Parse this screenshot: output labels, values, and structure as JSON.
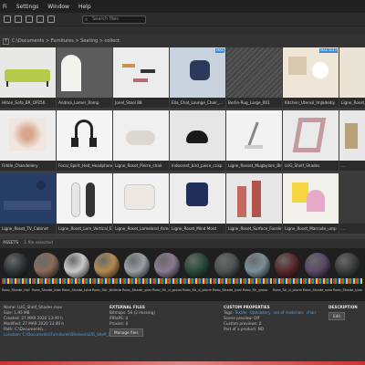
{
  "menubar": {
    "items": [
      "Fi",
      "Settings",
      "Window",
      "Help"
    ]
  },
  "toolbar": {
    "search_placeholder": "Search files"
  },
  "breadcrumb": {
    "path": "C:\\Documents > Furnitures > Seating > collect"
  },
  "tiles": [
    {
      "label": "Hilton_Sofa_BR_OP250",
      "badge": ""
    },
    {
      "label": "Andrea_Lamer_Ramp",
      "badge": ""
    },
    {
      "label": "Jonel_Stool 88",
      "badge": ""
    },
    {
      "label": "Ella_Chat_Lounge_Chair_...",
      "badge": ""
    },
    {
      "label": "Berlin-Rug_Large_001",
      "badge": ""
    },
    {
      "label": "Kitchen_Utensil_ImJadedly",
      "badge": "MAX 2013"
    },
    {
      "label": "Ligne_Roset_...",
      "badge": ""
    },
    {
      "label": "Fiddle_Chandeliery",
      "badge": ""
    },
    {
      "label": "Focal_Spirit_Hed_Headphones",
      "badge": ""
    },
    {
      "label": "Ligne_Roset_Pierre_chair",
      "badge": ""
    },
    {
      "label": "Indoorest_bird_piece_crisp",
      "badge": ""
    },
    {
      "label": "Ligne_Rosset_Mugbylam_Bird_Lam",
      "badge": ""
    },
    {
      "label": "LUG_Shelf_Shades",
      "badge": ""
    },
    {
      "label": "...",
      "badge": ""
    },
    {
      "label": "Ligne_Roset_TV_Cabinet",
      "badge": ""
    },
    {
      "label": "Ligne_Roset_Lom_Vertical_Ext",
      "badge": ""
    },
    {
      "label": "Ligne_Roset_Lomeland_Armchair",
      "badge": ""
    },
    {
      "label": "Ligne_Roset_Mind Mont",
      "badge": ""
    },
    {
      "label": "Ligne_Roset_Surface_Faceline",
      "badge": ""
    },
    {
      "label": "Ligne_Roset_Marcade_ump",
      "badge": ""
    },
    {
      "label": "...",
      "badge": ""
    }
  ],
  "materials_header": {
    "title": "ASSETS",
    "count": "1 file selected"
  },
  "materials": [
    {
      "label": "Roro_Shade_Hol",
      "color": "#2f3538"
    },
    {
      "label": "Roro_Shade_blanc",
      "color": "#8a6a5c"
    },
    {
      "label": "Roro_Shade_Iside",
      "color": "#c9c9c9"
    },
    {
      "label": "Roro_Shr_Aldirdeat",
      "color": "#b28a52"
    },
    {
      "label": "Roro_Shade_gram",
      "color": "#9aa0a4"
    },
    {
      "label": "Roro_Sh_d_grous",
      "color": "#8a7a90"
    },
    {
      "label": "Roro_Sh_d_plums",
      "color": "#2a4a3a"
    },
    {
      "label": "Roro_Shade_Ijorm",
      "color": "#4c5452"
    },
    {
      "label": "Roro_Sh_gross",
      "color": "#7b8f96"
    },
    {
      "label": "Roro_Sh_d_plums2",
      "color": "#5a2a2a"
    },
    {
      "label": "Roro_Shade_sandpath",
      "color": "#5a4a6a"
    },
    {
      "label": "Roro_Shade_Ijonm",
      "color": "#3a3f3c"
    }
  ],
  "details": {
    "left_lines": [
      "Name: LUG_Shelf_Shades.max",
      "Size: 1.95 MB",
      "Created: 27 MAR 2020 13:49 h",
      "Modified: 27 MAR 2020 13:49 h",
      "Path: C:\\Documents\\...",
      "Location: C:\\Documents\\Furnitures\\Shelves\\LUG_Shelf_Shades"
    ],
    "external_title": "EXTERNAL FILES",
    "external_lines": [
      "Bitmaps: 56 (2 missing)",
      "IRRaPS: 0",
      "Proxies: 0"
    ],
    "external_button": "Manage files",
    "custom_title": "CUSTOM PROPERTIES",
    "custom_tags_label": "Tags:",
    "custom_tags": [
      "Textile",
      "Upholstery",
      "set of materials",
      "chair"
    ],
    "custom_lines": [
      "Scene preview: Off",
      "Custom previews: 0",
      "Part of a product: NO"
    ],
    "desc_title": "DESCRIPTION",
    "desc_button": "Edit"
  }
}
